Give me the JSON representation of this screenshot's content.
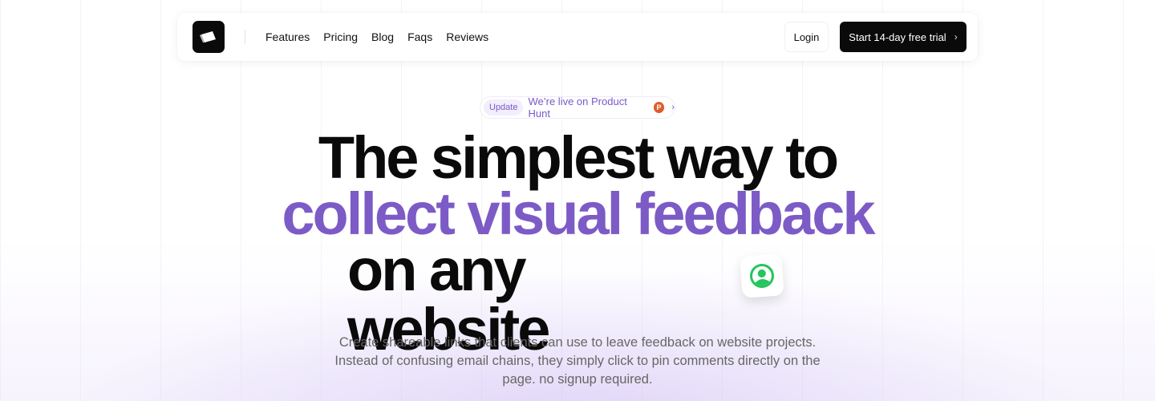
{
  "nav": {
    "logo_icon": "logo-icon",
    "links": [
      "Features",
      "Pricing",
      "Blog",
      "Faqs",
      "Reviews"
    ],
    "login_label": "Login",
    "cta_label": "Start 14-day free trial"
  },
  "announcement": {
    "tag": "Update",
    "text": "We’re live on Product Hunt",
    "badge": "P"
  },
  "hero": {
    "line1": "The simplest way to",
    "line2": "collect visual feedback",
    "line3": "on any website",
    "avatar_icon": "user-circle-icon",
    "subtext": "Create shareable links that clients can use to leave feedback on website projects. Instead of confusing email chains, they simply click to pin comments directly on the page. no signup required."
  },
  "colors": {
    "accent": "#7c5bc6",
    "cta_bg": "#0a0a0a",
    "avatar_green": "#22c55e",
    "product_hunt": "#e05b2b"
  }
}
